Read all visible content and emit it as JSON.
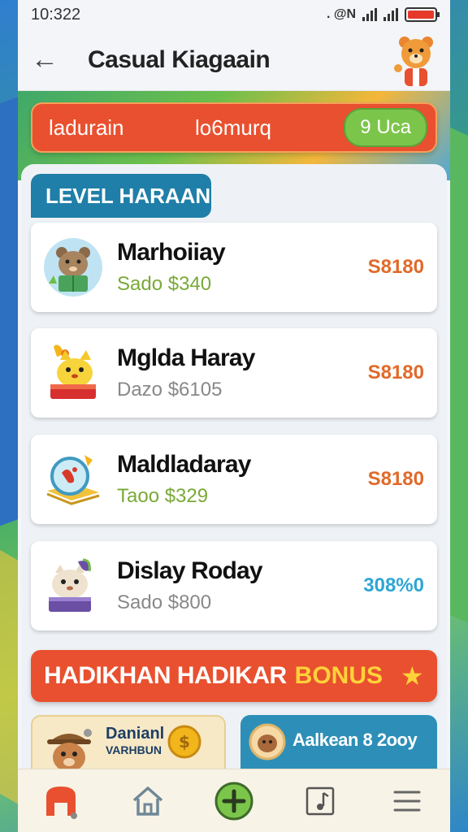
{
  "status": {
    "time": "10:322",
    "icons": ". @N"
  },
  "header": {
    "title": "Casual Kiagaain"
  },
  "promo": {
    "left": "ladurain",
    "middle": "lo6murq",
    "pill": "9 Uca"
  },
  "level": {
    "label": "LEVEL HARAAN"
  },
  "items": [
    {
      "name": "Marhoiiay",
      "sub": "Sado $340",
      "price": "S8180",
      "sub_color": "#79a936",
      "price_color": "#e06a2a"
    },
    {
      "name": "Mglda Haray",
      "sub": "Dazo $6105",
      "price": "S8180",
      "sub_color": "#888888",
      "price_color": "#e06a2a"
    },
    {
      "name": "Maldladaray",
      "sub": "Taoo $329",
      "price": "S8180",
      "sub_color": "#79a936",
      "price_color": "#e06a2a"
    },
    {
      "name": "Dislay Roday",
      "sub": "Sado $800",
      "price": "308%0",
      "sub_color": "#888888",
      "price_color": "#2fa6d4"
    }
  ],
  "bonus": {
    "main": "HADIKHAN HADIKAR",
    "word": "BONUS"
  },
  "cards": {
    "left": {
      "title": "Danianl",
      "sub": "VARHBUN"
    },
    "right": {
      "title": "Aalkean 8 2ooy"
    }
  },
  "tabs": [
    "home-app-icon",
    "house-icon",
    "plus-circle-icon",
    "music-note-icon",
    "menu-icon"
  ],
  "colors": {
    "accent": "#e9502f",
    "level": "#1f7fa8",
    "bonus_word": "#ffd23a"
  }
}
